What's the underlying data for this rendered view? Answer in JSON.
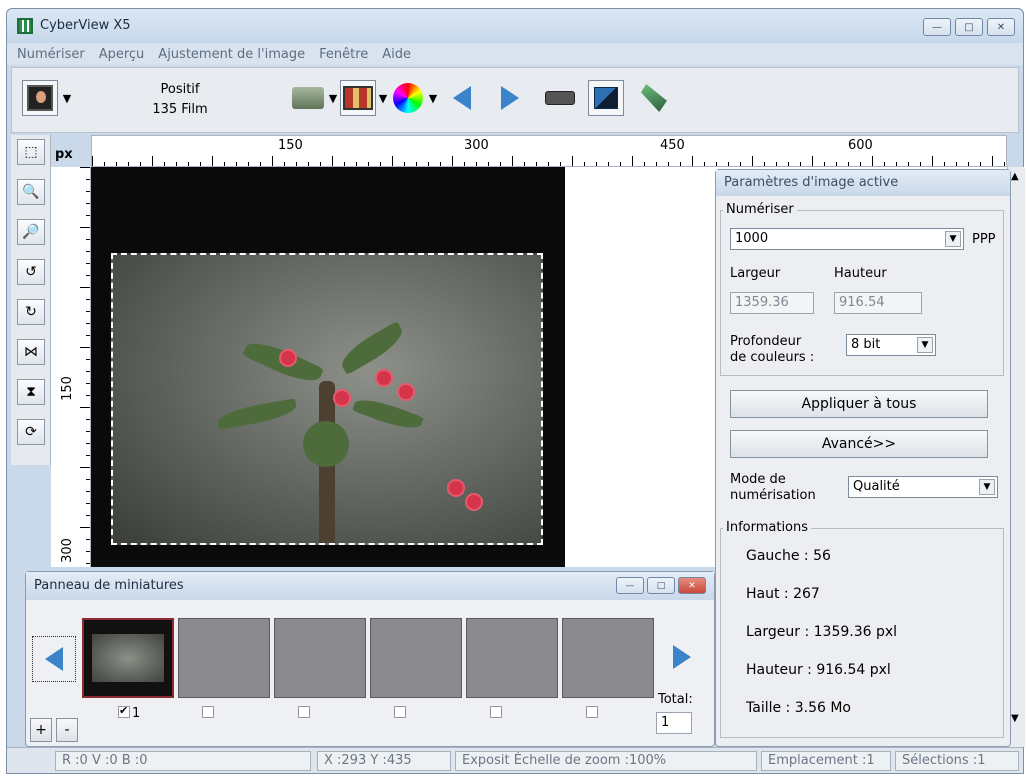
{
  "window": {
    "title": "CyberView X5",
    "min_label": "—",
    "max_label": "□",
    "close_label": "✕"
  },
  "menu": [
    "Numériser",
    "Aperçu",
    "Ajustement de l'image",
    "Fenêtre",
    "Aide"
  ],
  "toolbar": {
    "mode_line1": "Positif",
    "mode_line2": "135 Film",
    "drop_symbol": "▼"
  },
  "ruler": {
    "unit": "px",
    "h_labels": [
      "150",
      "300",
      "450",
      "600"
    ],
    "v_labels": [
      "150",
      "300"
    ]
  },
  "params": {
    "title": "Paramètres d'image active",
    "scan_group": "Numériser",
    "resolution": "1000",
    "resolution_unit": "PPP",
    "width_label": "Largeur",
    "height_label": "Hauteur",
    "width_value": "1359.36",
    "height_value": "916.54",
    "depth_label_1": "Profondeur",
    "depth_label_2": "de couleurs :",
    "depth_value": "8 bit",
    "apply_all": "Appliquer à tous",
    "advanced": "Avancé>>",
    "scan_mode_label_1": "Mode de",
    "scan_mode_label_2": "numérisation",
    "scan_mode_value": "Qualité",
    "info_group": "Informations",
    "info": [
      "Gauche : 56",
      "Haut : 267",
      "Largeur : 1359.36 pxl",
      "Hauteur : 916.54 pxl",
      "Taille : 3.56 Mo"
    ]
  },
  "thumbs": {
    "title": "Panneau de miniatures",
    "selected_label": "1",
    "total_label": "Total:",
    "total_value": "1",
    "add": "+",
    "remove": "-"
  },
  "status": {
    "rgb": "R :0 V :0 B :0",
    "coords": "X :293 Y :435",
    "zoom": "Exposit Échelle de zoom :100%",
    "location": "Emplacement :1",
    "selections": "Sélections :1"
  }
}
